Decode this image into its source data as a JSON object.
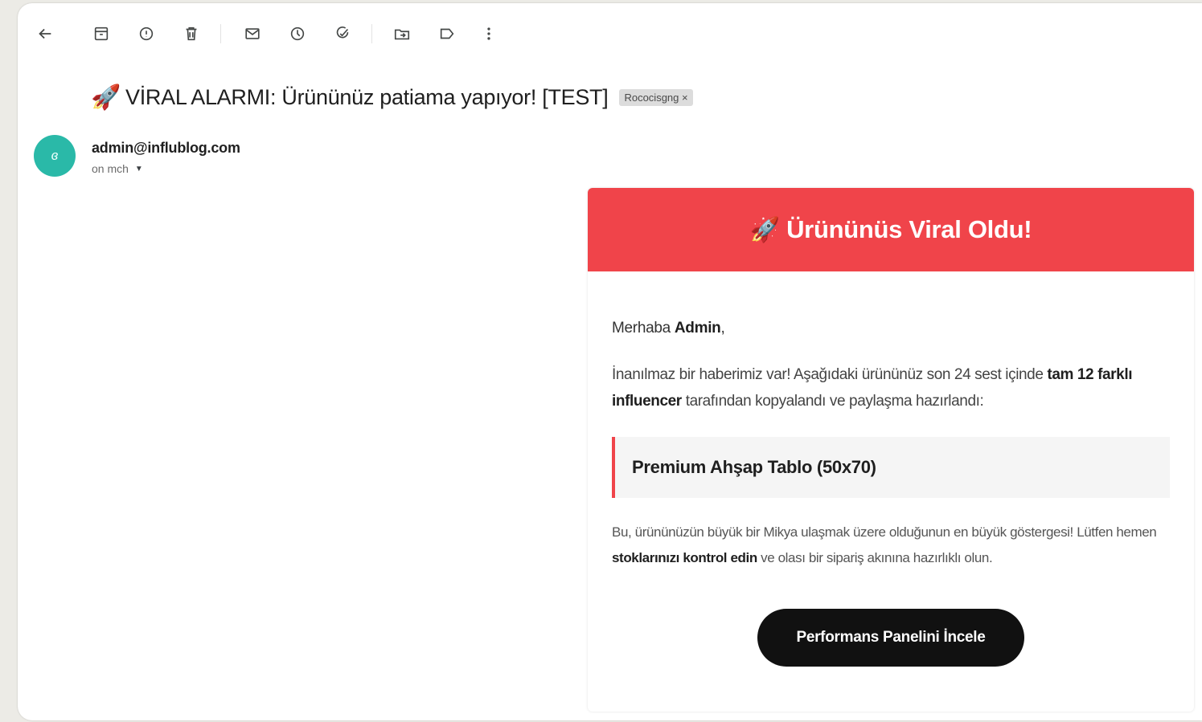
{
  "toolbar": {
    "icons": [
      "back-arrow-icon",
      "archive-icon",
      "report-spam-icon",
      "delete-icon",
      "mark-unread-icon",
      "snooze-icon",
      "add-to-tasks-icon",
      "move-to-icon",
      "label-icon",
      "more-options-icon"
    ]
  },
  "email": {
    "subject_emoji": "🚀",
    "subject": "VİRAL ALARMI: Ürününüz patiama yapıyor! [TEST]",
    "label_chip": "Rococisgng ×",
    "sender": {
      "avatar_initial": "ɞ",
      "avatar_color": "#2ab9a8",
      "email": "admin@influblog.com",
      "to_line": "on mch"
    }
  },
  "card": {
    "header_color": "#f0444a",
    "header_emoji": "🚀",
    "header_title": "Ürününüs Viral Oldu!",
    "greeting_prefix": "Merhaba ",
    "greeting_name": "Admin",
    "greeting_suffix": ",",
    "intro_part1": "İnanılmaz bir haberimiz var! Aşağıdaki ürününüz son 24 sest içinde ",
    "intro_bold": "tam 12 farklı influencer",
    "intro_part2": " tarafından kopyalandı ve paylaşma hazırlandı:",
    "product_name": "Premium Ahşap Tablo (50x70)",
    "note_part1": "Bu, ürününüzün büyük bir Mikya ulaşmak üzere olduğunun en büyük göstergesi! Lütfen hemen ",
    "note_bold": "stoklarınızı kontrol edin",
    "note_part2": " ve olası bir sipariş akınına hazırlıklı olun.",
    "cta_label": "Performans Panelini İncele",
    "cta_color": "#111111"
  }
}
